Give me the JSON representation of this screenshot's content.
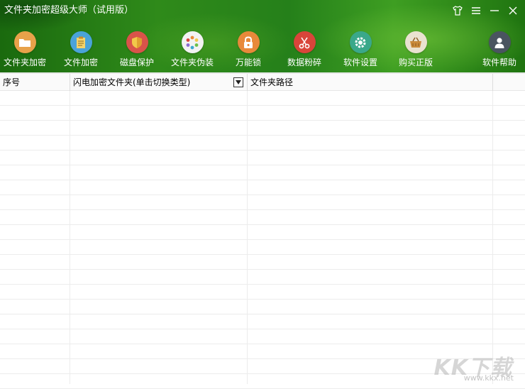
{
  "window": {
    "title": "文件夹加密超级大师（试用版）"
  },
  "toolbar": {
    "items": [
      {
        "label": "文件夹加密",
        "icon": "folder-lock-icon",
        "color": "#e8a24a"
      },
      {
        "label": "文件加密",
        "icon": "document-icon",
        "color": "#4aa3d9"
      },
      {
        "label": "磁盘保护",
        "icon": "shield-icon",
        "color": "#d9534a"
      },
      {
        "label": "文件夹伪装",
        "icon": "color-wheel-icon",
        "color": "#f2f2f2"
      },
      {
        "label": "万能锁",
        "icon": "padlock-icon",
        "color": "#e8893a"
      },
      {
        "label": "数据粉碎",
        "icon": "scissors-icon",
        "color": "#d9453a"
      },
      {
        "label": "软件设置",
        "icon": "gear-icon",
        "color": "#3aa88a"
      },
      {
        "label": "购买正版",
        "icon": "shopping-basket-icon",
        "color": "#e9e2d0"
      },
      {
        "label": "软件帮助",
        "icon": "help-user-icon",
        "color": "#4a5460"
      }
    ]
  },
  "table": {
    "columns": [
      "序号",
      "闪电加密文件夹(单击切换类型)",
      "文件夹路径"
    ],
    "rows": []
  },
  "watermark": {
    "main": "KK下载",
    "sub": "www.kkx.net"
  },
  "colors": {
    "header_green": "#2f8a1a",
    "grid_line": "#ececec"
  }
}
